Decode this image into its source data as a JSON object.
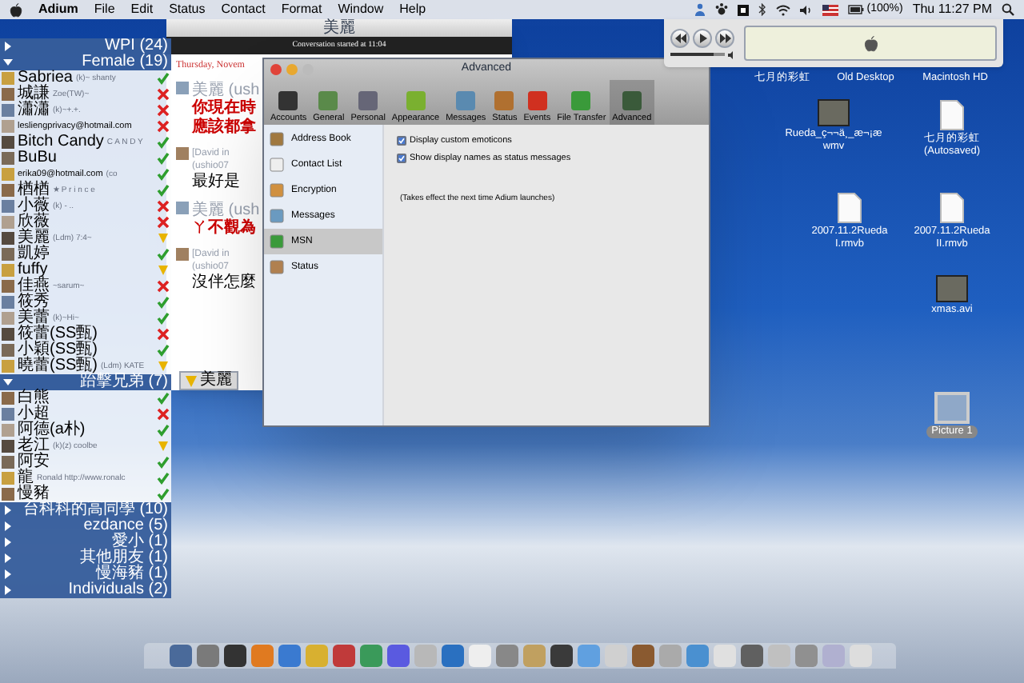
{
  "menu_bar": {
    "items": [
      "Adium",
      "File",
      "Edit",
      "Status",
      "Contact",
      "Format",
      "Window",
      "Help"
    ],
    "battery": "(100%)",
    "clock": "Thu 11:27 PM"
  },
  "contact_list": {
    "groups": [
      {
        "name": "WPI (24)",
        "expanded": false
      },
      {
        "name": "Female (19)",
        "expanded": true,
        "contacts": [
          {
            "name": "Sabriea",
            "message": "(k)~ shanty",
            "kind": "available"
          },
          {
            "name": "城謙",
            "message": "Zoe(TW)~",
            "kind": "offline"
          },
          {
            "name": "瀟瀟",
            "message": "(k)~+.+.",
            "kind": "offline"
          },
          {
            "name": "lesliengprivacy@hotmail.com",
            "kind": "offline"
          },
          {
            "name": "Bitch Candy",
            "message": "C A N D Y",
            "kind": "available"
          },
          {
            "name": "BuBu",
            "kind": "available"
          },
          {
            "name": "erika09@hotmail.com",
            "message": "(co",
            "kind": "available"
          },
          {
            "name": "楢楢",
            "message": "★ P r i n c e",
            "kind": "available"
          },
          {
            "name": "小薇",
            "message": "(k) - ..",
            "kind": "offline"
          },
          {
            "name": "欣薇",
            "kind": "offline"
          },
          {
            "name": "美麗",
            "message": "(Ldm) 7:4~",
            "kind": "away"
          },
          {
            "name": "凱婷",
            "kind": "available"
          },
          {
            "name": "fuffy",
            "kind": "away"
          },
          {
            "name": "佳燕",
            "message": "~sarum~",
            "kind": "offline"
          },
          {
            "name": "筱秀",
            "kind": "available"
          },
          {
            "name": "美蕾",
            "message": "(k)~Hi~",
            "kind": "available"
          },
          {
            "name": "筱蕾(SS甄)",
            "kind": "offline"
          },
          {
            "name": "小穎(SS甄)",
            "kind": "available"
          },
          {
            "name": "曉蕾(SS甄)",
            "message": "(Ldm) KATE",
            "kind": "away"
          }
        ]
      },
      {
        "name": "跆擊兄弟 (7)",
        "expanded": true,
        "contacts": [
          {
            "name": "白熊",
            "kind": "available"
          },
          {
            "name": "小超",
            "kind": "offline"
          },
          {
            "name": "阿德(a朴)",
            "kind": "available"
          },
          {
            "name": "老江",
            "message": "(k)(z) coolbe",
            "kind": "away"
          },
          {
            "name": "阿安",
            "kind": "available"
          },
          {
            "name": "龍",
            "message": "Ronald http://www.ronalc",
            "kind": "available"
          },
          {
            "name": "慢豬",
            "kind": "available"
          }
        ]
      },
      {
        "name": "台科科的高同學 (10)",
        "expanded": false
      },
      {
        "name": "ezdance (5)",
        "expanded": false
      },
      {
        "name": "愛小 (1)",
        "expanded": false
      },
      {
        "name": "其他朋友 (1)",
        "expanded": false
      },
      {
        "name": "慢海豬 (1)",
        "expanded": false
      },
      {
        "name": "Individuals (2)",
        "expanded": false
      }
    ]
  },
  "chat_window": {
    "title": "美麗",
    "banner": "Conversation started at 11:04",
    "date": "Thursday, Novem",
    "messages": [
      {
        "sender": "美麗 (ush",
        "lines": [
          "你現在時",
          "應該都拿"
        ],
        "kind": "incoming"
      },
      {
        "sender": "[David in",
        "sub": "(ushio07",
        "lines": [
          "最好是"
        ],
        "kind": "outgoing"
      },
      {
        "sender": "美麗 (ush",
        "lines": [
          "ㄚ不觀為"
        ],
        "kind": "incoming"
      },
      {
        "sender": "[David in",
        "sub": "(ushio07",
        "lines": [
          "沒伴怎麼"
        ],
        "kind": "outgoing"
      }
    ],
    "tab": "美麗"
  },
  "preferences": {
    "title": "Advanced",
    "toolbar": [
      {
        "label": "Accounts",
        "selected": false
      },
      {
        "label": "General",
        "selected": false
      },
      {
        "label": "Personal",
        "selected": false
      },
      {
        "label": "Appearance",
        "selected": false
      },
      {
        "label": "Messages",
        "selected": false
      },
      {
        "label": "Status",
        "selected": false
      },
      {
        "label": "Events",
        "selected": false
      },
      {
        "label": "File Transfer",
        "selected": false
      },
      {
        "label": "Advanced",
        "selected": true
      }
    ],
    "sidebar": [
      {
        "label": "Address Book",
        "selected": false
      },
      {
        "label": "Contact List",
        "selected": false
      },
      {
        "label": "Encryption",
        "selected": false
      },
      {
        "label": "Messages",
        "selected": false
      },
      {
        "label": "MSN",
        "selected": true
      },
      {
        "label": "Status",
        "selected": false
      }
    ],
    "options": [
      {
        "label": "Display custom emoticons",
        "checked": true
      },
      {
        "label": "Show display names as status messages",
        "checked": true
      }
    ],
    "note": "(Takes effect the next time Adium launches)"
  },
  "music_player": {
    "volume": {
      "level": 0.78
    }
  },
  "desktop_icons": [
    {
      "label": "七月的彩虹",
      "kind": "plain"
    },
    {
      "label": "Old Desktop",
      "kind": "plain"
    },
    {
      "label": "Macintosh HD",
      "kind": "plain"
    },
    {
      "label": "Rueda_ç¬¬ä¸_æ¬¡æ",
      "label2": "wmv",
      "kind": "video"
    },
    {
      "label": "七月的彩虹",
      "label2": "(Autosaved)",
      "kind": "document"
    },
    {
      "label": "2007.11.2Rueda",
      "label2": "I.rmvb",
      "kind": "document"
    },
    {
      "label": "2007.11.2Rueda",
      "label2": "II.rmvb",
      "kind": "document"
    },
    {
      "label": "xmas.avi",
      "kind": "video"
    },
    {
      "label": "Picture 1",
      "kind": "image"
    }
  ]
}
